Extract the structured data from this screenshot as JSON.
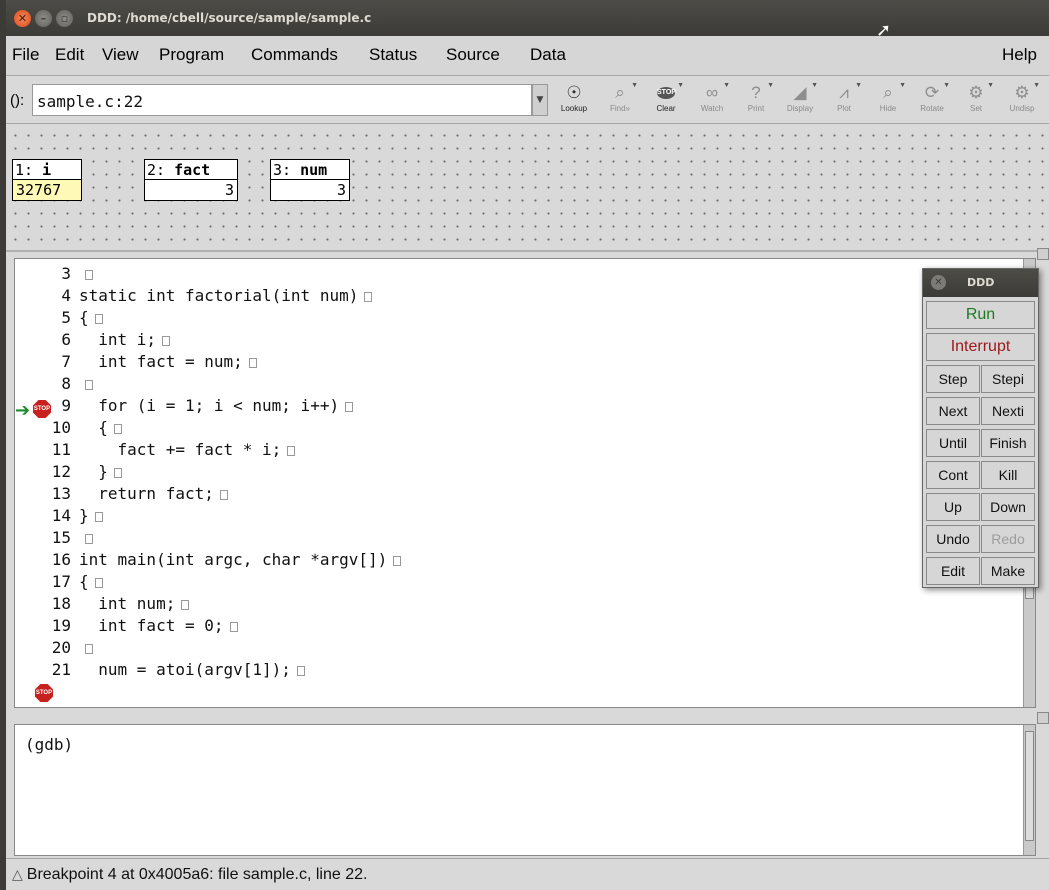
{
  "window": {
    "title": "DDD: /home/cbell/source/sample/sample.c"
  },
  "menu": {
    "items": [
      "File",
      "Edit",
      "View",
      "Program",
      "Commands",
      "Status",
      "Source",
      "Data"
    ],
    "help": "Help"
  },
  "toolbar": {
    "arg_prefix": "():",
    "arg_value": "sample.c:22",
    "tools": [
      {
        "label": "Lookup",
        "icon": "lookup-icon",
        "glyph": "☉"
      },
      {
        "label": "Find»",
        "icon": "find-icon",
        "glyph": "⌕"
      },
      {
        "label": "Clear",
        "icon": "clear-stop-icon",
        "glyph": "STOP"
      },
      {
        "label": "Watch",
        "icon": "watch-icon",
        "glyph": "∞"
      },
      {
        "label": "Print",
        "icon": "print-icon",
        "glyph": "?"
      },
      {
        "label": "Display",
        "icon": "display-icon",
        "glyph": "◢"
      },
      {
        "label": "Plot",
        "icon": "plot-icon",
        "glyph": "⩘"
      },
      {
        "label": "Hide",
        "icon": "hide-icon",
        "glyph": "⌕"
      },
      {
        "label": "Rotate",
        "icon": "rotate-icon",
        "glyph": "⟳"
      },
      {
        "label": "Set",
        "icon": "set-icon",
        "glyph": "⚙"
      },
      {
        "label": "Undisp",
        "icon": "undisplay-icon",
        "glyph": "⚙"
      }
    ]
  },
  "displays": [
    {
      "num": "1:",
      "name": "i",
      "value": "32767"
    },
    {
      "num": "2:",
      "name": "fact",
      "value": "3"
    },
    {
      "num": "3:",
      "name": "num",
      "value": "3"
    }
  ],
  "source": {
    "lines": [
      {
        "n": "3",
        "code": ""
      },
      {
        "n": "4",
        "code": "static int factorial(int num)"
      },
      {
        "n": "5",
        "code": "{"
      },
      {
        "n": "6",
        "code": "  int i;"
      },
      {
        "n": "7",
        "code": "  int fact = num;"
      },
      {
        "n": "8",
        "code": ""
      },
      {
        "n": "9",
        "code": "  for (i = 1; i < num; i++)"
      },
      {
        "n": "10",
        "code": "  {"
      },
      {
        "n": "11",
        "code": "    fact += fact * i;"
      },
      {
        "n": "12",
        "code": "  }"
      },
      {
        "n": "13",
        "code": "  return fact;"
      },
      {
        "n": "14",
        "code": "}"
      },
      {
        "n": "15",
        "code": ""
      },
      {
        "n": "16",
        "code": "int main(int argc, char *argv[])"
      },
      {
        "n": "17",
        "code": "{"
      },
      {
        "n": "18",
        "code": "  int num;"
      },
      {
        "n": "19",
        "code": "  int fact = 0;"
      },
      {
        "n": "20",
        "code": ""
      },
      {
        "n": "21",
        "code": "  num = atoi(argv[1]);"
      }
    ],
    "breakpoint_label": "STOP"
  },
  "command_tool": {
    "title": "DDD",
    "run": "Run",
    "interrupt": "Interrupt",
    "buttons": [
      [
        "Step",
        "Stepi"
      ],
      [
        "Next",
        "Nexti"
      ],
      [
        "Until",
        "Finish"
      ],
      [
        "Cont",
        "Kill"
      ],
      [
        "Up",
        "Down"
      ],
      [
        "Undo",
        "Redo"
      ],
      [
        "Edit",
        "Make"
      ]
    ]
  },
  "console": {
    "prompt": "(gdb)"
  },
  "status": {
    "text": "Breakpoint 4 at 0x4005a6: file sample.c, line 22."
  }
}
